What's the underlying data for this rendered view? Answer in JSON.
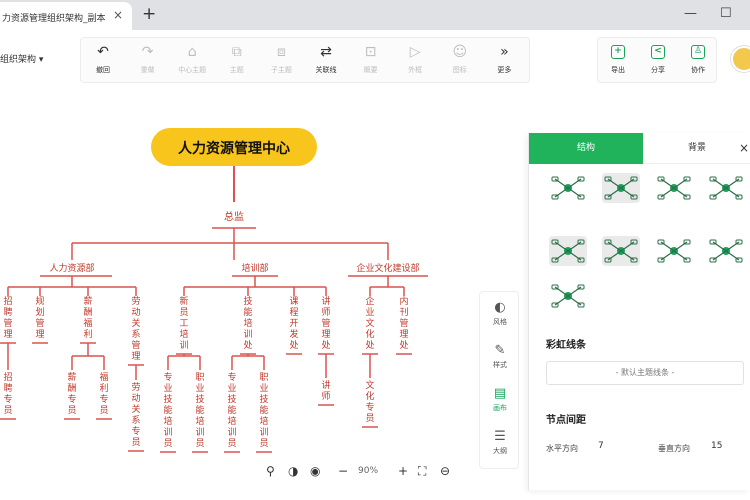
{
  "browser": {
    "tab_title": "力资源管理组织架构_副本",
    "tab_close": "×",
    "new_tab": "+",
    "minimize": "—",
    "maximize": "☐"
  },
  "doc": {
    "name_fragment": "组织架构 ▾"
  },
  "toolbar": {
    "items": [
      {
        "label": "撤回",
        "icon": "undo-icon",
        "glyph": "↶",
        "enabled": true
      },
      {
        "label": "重做",
        "icon": "redo-icon",
        "glyph": "↷",
        "enabled": false
      },
      {
        "label": "中心主题",
        "icon": "home-icon",
        "glyph": "⌂",
        "enabled": false
      },
      {
        "label": "主题",
        "icon": "topic-icon",
        "glyph": "⧉",
        "enabled": false
      },
      {
        "label": "子主题",
        "icon": "subtopic-icon",
        "glyph": "⧈",
        "enabled": false
      },
      {
        "label": "关联线",
        "icon": "relation-icon",
        "glyph": "⇄",
        "enabled": true
      },
      {
        "label": "概要",
        "icon": "summary-icon",
        "glyph": "⊡",
        "enabled": false
      },
      {
        "label": "外框",
        "icon": "frame-icon",
        "glyph": "▷",
        "enabled": false
      },
      {
        "label": "图标",
        "icon": "emoji-icon",
        "glyph": "☺",
        "enabled": false
      },
      {
        "label": "更多",
        "icon": "more-icon",
        "glyph": "»",
        "enabled": true
      }
    ],
    "right": [
      {
        "label": "导出",
        "icon": "export-icon",
        "glyph": "+"
      },
      {
        "label": "分享",
        "icon": "share-icon",
        "glyph": "<"
      },
      {
        "label": "协作",
        "icon": "collab-icon",
        "glyph": "♙"
      }
    ]
  },
  "mindmap": {
    "root": "人力资源管理中心",
    "level1": "总监",
    "departments": [
      "人力资源部",
      "培训部",
      "企业文化建设部"
    ],
    "leaves": [
      "招聘管理",
      "规划管理",
      "薪酬福利",
      "劳动关系管理",
      "新员工培训",
      "技能培训处",
      "课程开发处",
      "讲师管理处",
      "企业文化处",
      "内刊管理处",
      "招聘专员",
      "薪酬专员",
      "福利专员",
      "劳动关系专员",
      "专业技能培训员",
      "职业技能培训员",
      "专业技能培训员",
      "职业技能培训员",
      "讲师",
      "文化专员"
    ],
    "colors": {
      "root_fill": "#f7c51c",
      "line": "#d9534f",
      "text": "#c0392b"
    }
  },
  "side_strip": [
    {
      "label": "风格",
      "icon": "palette-icon",
      "glyph": "◐",
      "active": false
    },
    {
      "label": "样式",
      "icon": "brush-icon",
      "glyph": "✎",
      "active": false
    },
    {
      "label": "画布",
      "icon": "canvas-icon",
      "glyph": "▤",
      "active": true
    },
    {
      "label": "大纲",
      "icon": "outline-icon",
      "glyph": "☰",
      "active": false
    }
  ],
  "panel": {
    "tab_active": "结构",
    "tab_other": "背景",
    "close": "×",
    "rainbow_title": "彩虹线条",
    "rainbow_value": "- 默认主题线条 -",
    "spacing_title": "节点间距",
    "horizontal_label": "水平方向",
    "horizontal_value": "7",
    "vertical_label": "垂直方向",
    "vertical_value": "15"
  },
  "zoom": {
    "percent": "90%",
    "minus": "−",
    "plus": "+"
  },
  "accent": "#20b35c"
}
